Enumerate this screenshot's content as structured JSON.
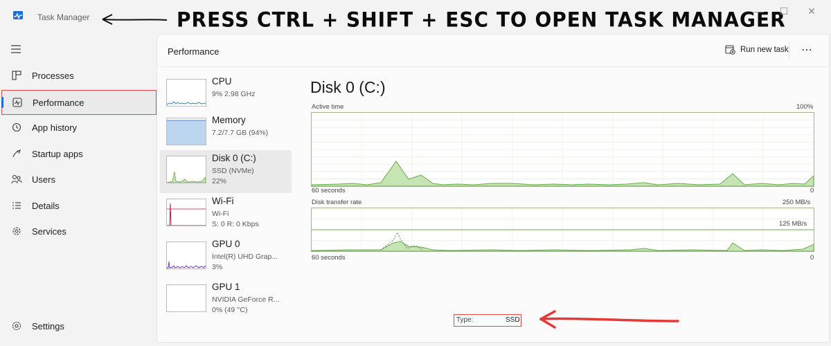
{
  "window": {
    "title": "Task Manager",
    "minimize": "—",
    "maximize": "☐",
    "close": "✕"
  },
  "annotation": {
    "callout": "PRESS CTRL + SHIFT + ESC TO OPEN TASK MANAGER"
  },
  "sidebar": {
    "menu_icon": "hamburger-icon",
    "items": [
      {
        "label": "Processes",
        "icon": "processes-icon"
      },
      {
        "label": "Performance",
        "icon": "performance-icon"
      },
      {
        "label": "App history",
        "icon": "history-icon"
      },
      {
        "label": "Startup apps",
        "icon": "startup-icon"
      },
      {
        "label": "Users",
        "icon": "users-icon"
      },
      {
        "label": "Details",
        "icon": "details-icon"
      },
      {
        "label": "Services",
        "icon": "services-icon"
      }
    ],
    "settings": {
      "label": "Settings",
      "icon": "gear-icon"
    }
  },
  "header": {
    "title": "Performance",
    "run_task": "Run new task",
    "more": "⋯"
  },
  "resources": [
    {
      "name": "CPU",
      "line1": "9% 2.98 GHz",
      "line2": ""
    },
    {
      "name": "Memory",
      "line1": "7.2/7.7 GB (94%)",
      "line2": ""
    },
    {
      "name": "Disk 0 (C:)",
      "line1": "SSD (NVMe)",
      "line2": "22%"
    },
    {
      "name": "Wi-Fi",
      "line1": "Wi-Fi",
      "line2": "S: 0 R: 0 Kbps"
    },
    {
      "name": "GPU 0",
      "line1": "Intel(R) UHD Grap...",
      "line2": "3%"
    },
    {
      "name": "GPU 1",
      "line1": "NVIDIA GeForce R...",
      "line2": "0% (49 °C)"
    }
  ],
  "detail": {
    "title": "Disk 0 (C:)",
    "active_time": {
      "label": "Active time",
      "max": "100%",
      "xleft": "60 seconds",
      "xright": "0"
    },
    "transfer_rate": {
      "label": "Disk transfer rate",
      "max": "250 MB/s",
      "mid": "125 MB/s",
      "xleft": "60 seconds",
      "xright": "0"
    },
    "type_label": "Type:",
    "type_value": "SSD"
  },
  "colors": {
    "accent": "#1670c7",
    "disk_line": "#6aa84f",
    "disk_fill": "#c7e4b3",
    "annotation_red": "#e53935"
  }
}
